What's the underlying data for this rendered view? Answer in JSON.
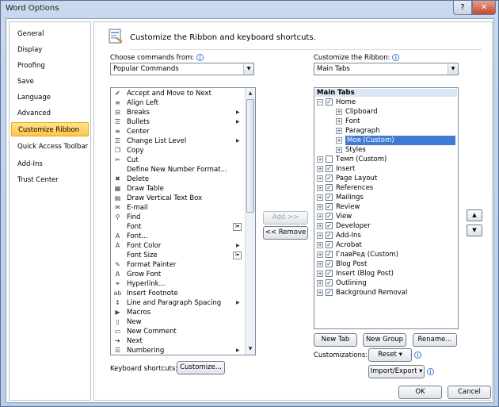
{
  "window": {
    "title": "Word Options",
    "help_label": "?",
    "close_label": "✕"
  },
  "nav": {
    "items": [
      {
        "label": "General"
      },
      {
        "label": "Display"
      },
      {
        "label": "Proofing"
      },
      {
        "label": "Save"
      },
      {
        "label": "Language"
      },
      {
        "label": "Advanced"
      },
      {
        "label": "Customize Ribbon"
      },
      {
        "label": "Quick Access Toolbar"
      },
      {
        "label": "Add-Ins"
      },
      {
        "label": "Trust Center"
      }
    ],
    "selected": "Customize Ribbon"
  },
  "header": {
    "title": "Customize the Ribbon and keyboard shortcuts."
  },
  "choose_commands": {
    "label": "Choose commands from:",
    "value": "Popular Commands"
  },
  "customize_ribbon": {
    "label": "Customize the Ribbon:",
    "value": "Main Tabs"
  },
  "commands": [
    {
      "label": "Accept and Move to Next",
      "icon": "✔"
    },
    {
      "label": "Align Left",
      "icon": "≡"
    },
    {
      "label": "Breaks",
      "icon": "⊟",
      "submenu": true
    },
    {
      "label": "Bullets",
      "icon": "☰",
      "submenu": true
    },
    {
      "label": "Center",
      "icon": "≡"
    },
    {
      "label": "Change List Level",
      "icon": "☰",
      "submenu": true
    },
    {
      "label": "Copy",
      "icon": "❐"
    },
    {
      "label": "Cut",
      "icon": "✂"
    },
    {
      "label": "Define New Number Format...",
      "icon": ""
    },
    {
      "label": "Delete",
      "icon": "✖"
    },
    {
      "label": "Draw Table",
      "icon": "▦"
    },
    {
      "label": "Draw Vertical Text Box",
      "icon": "▤"
    },
    {
      "label": "E-mail",
      "icon": "✉"
    },
    {
      "label": "Find",
      "icon": "⚲"
    },
    {
      "label": "Font",
      "icon": "",
      "box": "I▾"
    },
    {
      "label": "Font...",
      "icon": "A"
    },
    {
      "label": "Font Color",
      "icon": "A",
      "submenu": true
    },
    {
      "label": "Font Size",
      "icon": "",
      "box": "I▾"
    },
    {
      "label": "Format Painter",
      "icon": "✎"
    },
    {
      "label": "Grow Font",
      "icon": "A"
    },
    {
      "label": "Hyperlink...",
      "icon": "⚭"
    },
    {
      "label": "Insert Footnote",
      "icon": "ab"
    },
    {
      "label": "Line and Paragraph Spacing",
      "icon": "↕",
      "submenu": true
    },
    {
      "label": "Macros",
      "icon": "▶"
    },
    {
      "label": "New",
      "icon": "▯"
    },
    {
      "label": "New Comment",
      "icon": "▭"
    },
    {
      "label": "Next",
      "icon": "➜"
    },
    {
      "label": "Numbering",
      "icon": "☰",
      "submenu": true
    }
  ],
  "middle_buttons": {
    "add": "Add >>",
    "remove": "<< Remove"
  },
  "tree": {
    "header": "Main Tabs",
    "rows": [
      {
        "label": "Home",
        "level": 0,
        "expand": "−",
        "checked": true
      },
      {
        "label": "Clipboard",
        "level": 1,
        "expand": "+"
      },
      {
        "label": "Font",
        "level": 1,
        "expand": "+"
      },
      {
        "label": "Paragraph",
        "level": 1,
        "expand": "+"
      },
      {
        "label": "Моя (Custom)",
        "level": 1,
        "expand": "+",
        "selected": true
      },
      {
        "label": "Styles",
        "level": 1,
        "expand": "+"
      },
      {
        "label": "Темп (Custom)",
        "level": 0,
        "expand": "+",
        "checked": false
      },
      {
        "label": "Insert",
        "level": 0,
        "expand": "+",
        "checked": true
      },
      {
        "label": "Page Layout",
        "level": 0,
        "expand": "+",
        "checked": true
      },
      {
        "label": "References",
        "level": 0,
        "expand": "+",
        "checked": true
      },
      {
        "label": "Mailings",
        "level": 0,
        "expand": "+",
        "checked": true
      },
      {
        "label": "Review",
        "level": 0,
        "expand": "+",
        "checked": true
      },
      {
        "label": "View",
        "level": 0,
        "expand": "+",
        "checked": true
      },
      {
        "label": "Developer",
        "level": 0,
        "expand": "+",
        "checked": true
      },
      {
        "label": "Add-Ins",
        "level": 0,
        "expand": "+",
        "checked": true
      },
      {
        "label": "Acrobat",
        "level": 0,
        "expand": "+",
        "checked": true
      },
      {
        "label": "ГлавРед (Custom)",
        "level": 0,
        "expand": "+",
        "checked": true
      },
      {
        "label": "Blog Post",
        "level": 0,
        "expand": "+",
        "checked": true
      },
      {
        "label": "Insert (Blog Post)",
        "level": 0,
        "expand": "+",
        "checked": true
      },
      {
        "label": "Outlining",
        "level": 0,
        "expand": "+",
        "checked": true
      },
      {
        "label": "Background Removal",
        "level": 0,
        "expand": "+",
        "checked": true
      }
    ]
  },
  "tree_buttons": {
    "new_tab": "New Tab",
    "new_group": "New Group",
    "rename": "Rename..."
  },
  "customizations": {
    "label": "Customizations:",
    "reset": "Reset ▾",
    "import_export": "Import/Export ▾"
  },
  "keyboard": {
    "label": "Keyboard shortcuts:",
    "button": "Customize..."
  },
  "footer": {
    "ok": "OK",
    "cancel": "Cancel"
  }
}
